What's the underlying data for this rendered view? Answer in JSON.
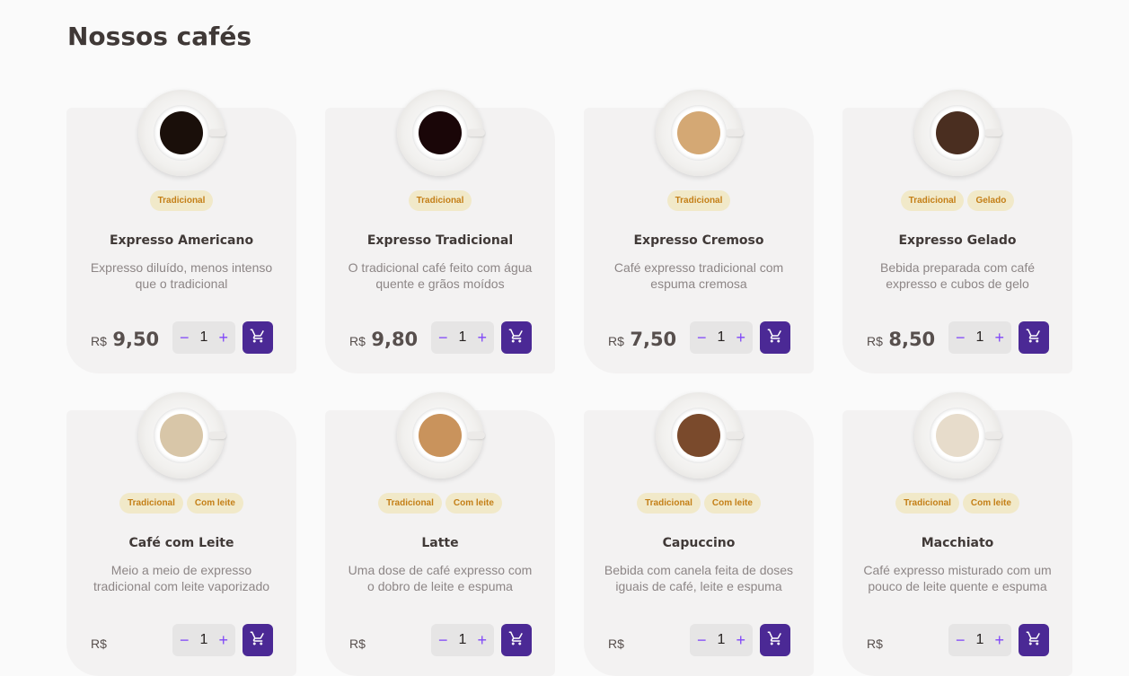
{
  "section_title": "Nossos cafés",
  "currency": "R$",
  "colors": {
    "accent": "#4b2995",
    "tag_bg": "#f1e9c9",
    "tag_text": "#c47f17"
  },
  "products": [
    {
      "name": "Expresso Americano",
      "description": "Expresso diluído, menos intenso que o tradicional",
      "price": "9,50",
      "quantity": "1",
      "tags": [
        "Tradicional"
      ],
      "liquid": "#1a0f0a"
    },
    {
      "name": "Expresso Tradicional",
      "description": "O tradicional café feito com água quente e grãos moídos",
      "price": "9,80",
      "quantity": "1",
      "tags": [
        "Tradicional"
      ],
      "liquid": "#1a0608"
    },
    {
      "name": "Expresso Cremoso",
      "description": "Café expresso tradicional com espuma cremosa",
      "price": "7,50",
      "quantity": "1",
      "tags": [
        "Tradicional"
      ],
      "liquid": "#d4a874"
    },
    {
      "name": "Expresso Gelado",
      "description": "Bebida preparada com café expresso e cubos de gelo",
      "price": "8,50",
      "quantity": "1",
      "tags": [
        "Tradicional",
        "Gelado"
      ],
      "liquid": "#4a2e20"
    },
    {
      "name": "Café com Leite",
      "description": "Meio a meio de expresso tradicional com leite vaporizado",
      "price": "",
      "quantity": "1",
      "tags": [
        "Tradicional",
        "Com leite"
      ],
      "liquid": "#d8c6a8"
    },
    {
      "name": "Latte",
      "description": "Uma dose de café expresso com o dobro de leite e espuma",
      "price": "",
      "quantity": "1",
      "tags": [
        "Tradicional",
        "Com leite"
      ],
      "liquid": "#c9935c"
    },
    {
      "name": "Capuccino",
      "description": "Bebida com canela feita de doses iguais de café, leite e espuma",
      "price": "",
      "quantity": "1",
      "tags": [
        "Tradicional",
        "Com leite"
      ],
      "liquid": "#7a4a2c"
    },
    {
      "name": "Macchiato",
      "description": "Café expresso misturado com um pouco de leite quente e espuma",
      "price": "",
      "quantity": "1",
      "tags": [
        "Tradicional",
        "Com leite"
      ],
      "liquid": "#e7dccb"
    }
  ],
  "icons": {
    "minus": "minus-icon",
    "plus": "plus-icon",
    "cart": "cart-icon"
  }
}
